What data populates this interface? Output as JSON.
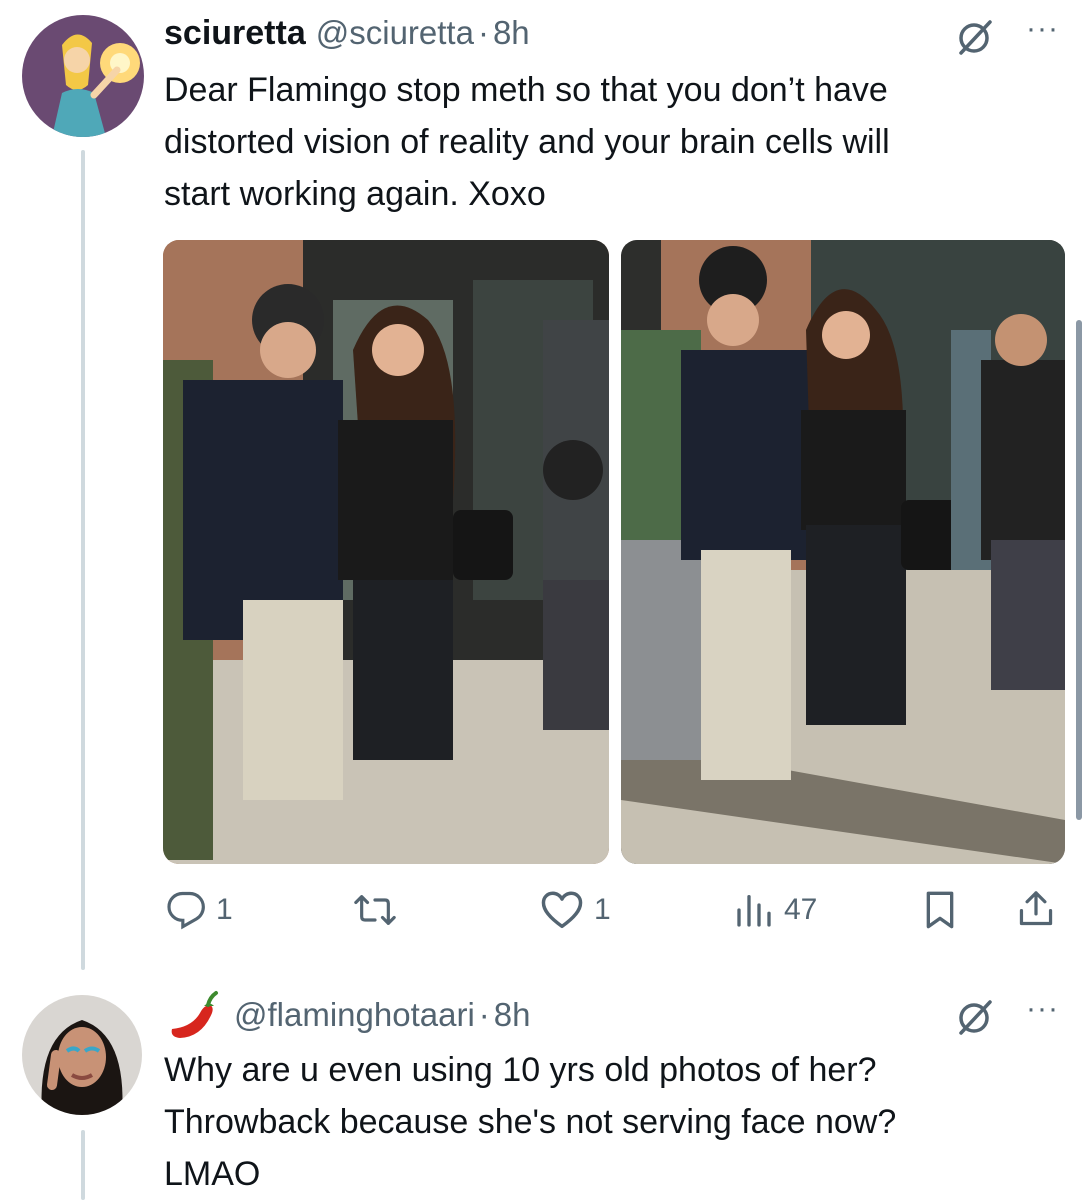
{
  "tweet1": {
    "display_name": "sciuretta",
    "handle": "@sciuretta",
    "separator": "·",
    "time": "8h",
    "text": "Dear Flamingo stop meth so that you don’t have\ndistorted vision of reality and your brain cells will\nstart working again. Xoxo",
    "actions": {
      "reply_count": "1",
      "retweet_count": "",
      "like_count": "1",
      "views_count": "47"
    }
  },
  "tweet2": {
    "display_name_emoji": "🌶️",
    "handle": "@flaminghotaari",
    "separator": "·",
    "time": "8h",
    "text": "Why are u even using 10 yrs old photos of her?\nThrowback because she's not serving face now?\nLMAO"
  },
  "more_glyph": "···",
  "colors": {
    "text": "#0f1419",
    "secondary": "#536471",
    "line": "#cfd9de",
    "chili": "#d7261e"
  }
}
